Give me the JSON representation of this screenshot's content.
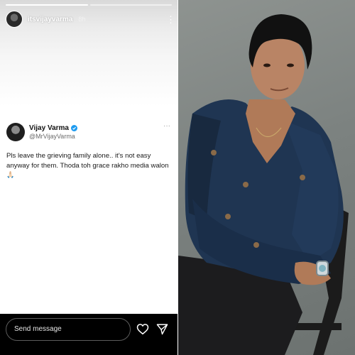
{
  "story": {
    "username": "itsvijayvarma",
    "time_ago": "8h",
    "progress": {
      "segments": 2,
      "active_index": 0
    }
  },
  "tweet": {
    "display_name": "Vijay Varma",
    "handle": "@MrVijayVarma",
    "text": "Pls leave the grieving family alone.. it's not easy anyway for them. Thoda toh grace rakho media walon",
    "emoji": "🙏🏻",
    "more": "···"
  },
  "reply": {
    "placeholder": "Send message"
  },
  "icons": {
    "kebab": "kebab-menu-icon",
    "heart": "heart-icon",
    "share": "paper-plane-icon",
    "verified": "verified-badge-icon"
  },
  "colors": {
    "verified": "#1d9bf0",
    "jacket": "#1f3552",
    "backdrop": "#7e8483"
  }
}
